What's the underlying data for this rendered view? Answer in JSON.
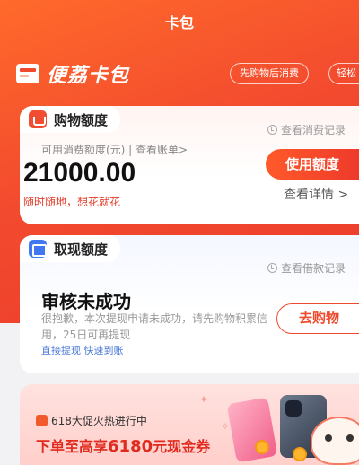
{
  "header": {
    "title": "卡包"
  },
  "brand": {
    "name": "便荔卡包"
  },
  "chips": [
    "先购物后消费",
    "轻松"
  ],
  "shopping": {
    "title": "购物额度",
    "record_link": "查看消费记录",
    "available_label": "可用消费额度(元) | 查看账单>",
    "amount": "21000.00",
    "slogan": "随时随地，想花就花",
    "use_button": "使用额度",
    "details_link": "查看详情 >"
  },
  "cash": {
    "title": "取现额度",
    "record_link": "查看借款记录",
    "status_title": "审核未成功",
    "status_desc": "很抱歉，本次提现申请未成功，请先购物积累信用，25日可再提现",
    "links": "直接提现  快速到账",
    "shop_button": "去购物"
  },
  "promo": {
    "tag": "618大促火热进行中",
    "title_prefix": "下单至高享",
    "title_amount": "6180",
    "title_suffix": "元现金券"
  },
  "colors": {
    "primary": "#ef4a2d",
    "link_blue": "#4b79d8"
  }
}
